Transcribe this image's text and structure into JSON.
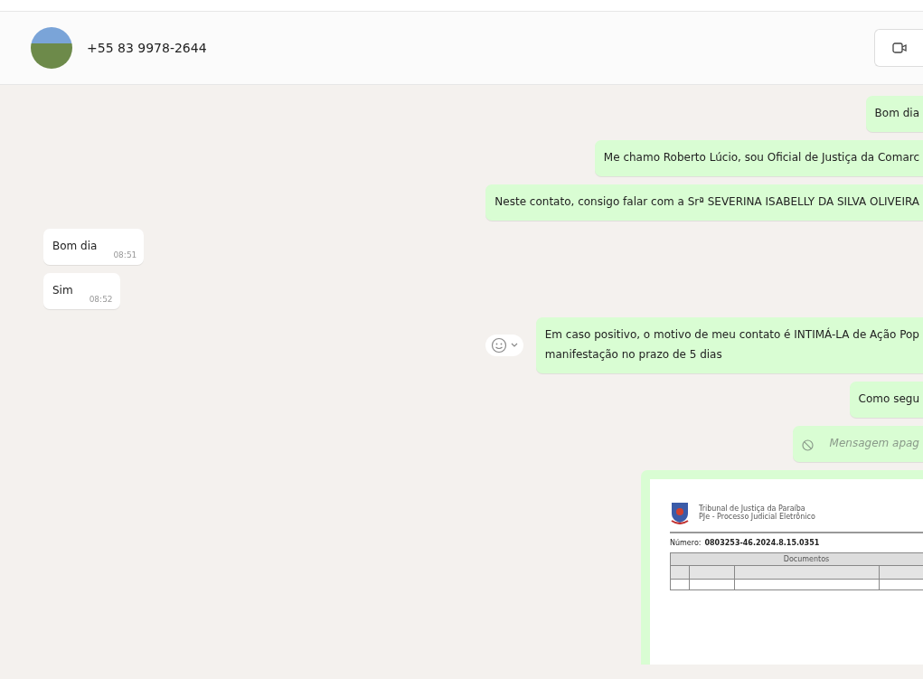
{
  "header": {
    "contact": "+55 83 9978-2644"
  },
  "messages": [
    {
      "kind": "text",
      "outgoing": true,
      "lines": [
        "Bom dia"
      ]
    },
    {
      "kind": "text",
      "outgoing": true,
      "lines": [
        "Me chamo Roberto Lúcio, sou Oficial de Justiça da Comarc"
      ]
    },
    {
      "kind": "text",
      "outgoing": true,
      "lines": [
        "Neste contato, consigo falar com a Srª SEVERINA ISABELLY DA SILVA OLIVEIRA"
      ]
    },
    {
      "kind": "text",
      "outgoing": false,
      "lines": [
        "Bom dia"
      ],
      "time": "08:51"
    },
    {
      "kind": "text",
      "outgoing": false,
      "lines": [
        "Sim"
      ],
      "time": "08:52"
    },
    {
      "kind": "text",
      "outgoing": true,
      "lines": [
        "Em caso positivo, o motivo de meu contato é INTIMÁ-LA de Ação Pop",
        "manifestação no prazo de 5 dias"
      ],
      "show_actions": true
    },
    {
      "kind": "text",
      "outgoing": true,
      "lines": [
        "Como segu"
      ]
    },
    {
      "kind": "deleted",
      "outgoing": true,
      "lines": [
        "Mensagem apag"
      ]
    },
    {
      "kind": "document",
      "outgoing": true,
      "document": {
        "court": "Tribunal de Justiça da Paraíba",
        "system": "PJe - Processo Judicial Eletrônico",
        "number_label": "Número:",
        "number": "0803253-46.2024.8.15.0351",
        "table_title": "Documentos"
      }
    }
  ]
}
